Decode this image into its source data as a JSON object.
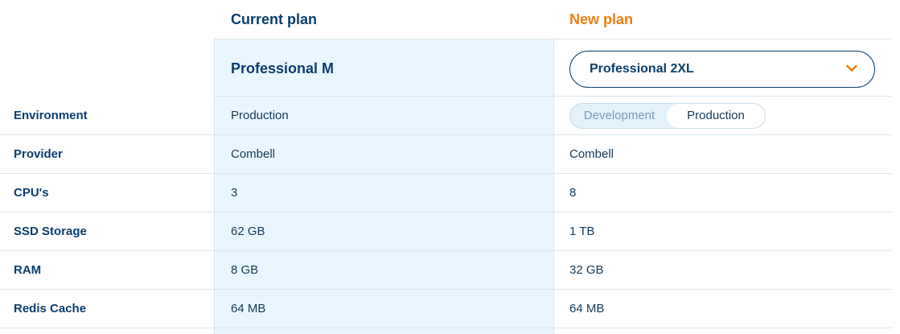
{
  "headers": {
    "current": "Current plan",
    "new": "New plan"
  },
  "plans": {
    "current": "Professional M",
    "new_selected": "Professional 2XL"
  },
  "environment_toggle": {
    "options": [
      "Development",
      "Production"
    ],
    "selected": "Production"
  },
  "rows": [
    {
      "label": "Environment",
      "current": "Production",
      "new": ""
    },
    {
      "label": "Provider",
      "current": "Combell",
      "new": "Combell"
    },
    {
      "label": "CPU's",
      "current": "3",
      "new": "8"
    },
    {
      "label": "SSD Storage",
      "current": "62 GB",
      "new": "1 TB"
    },
    {
      "label": "RAM",
      "current": "8 GB",
      "new": "32 GB"
    },
    {
      "label": "Redis Cache",
      "current": "64 MB",
      "new": "64 MB"
    }
  ],
  "colors": {
    "navy": "#0b3e6e",
    "orange": "#f07d12",
    "current_column_bg": "#eaf6fd"
  },
  "icons": {
    "dropdown": "chevron-down-icon"
  }
}
